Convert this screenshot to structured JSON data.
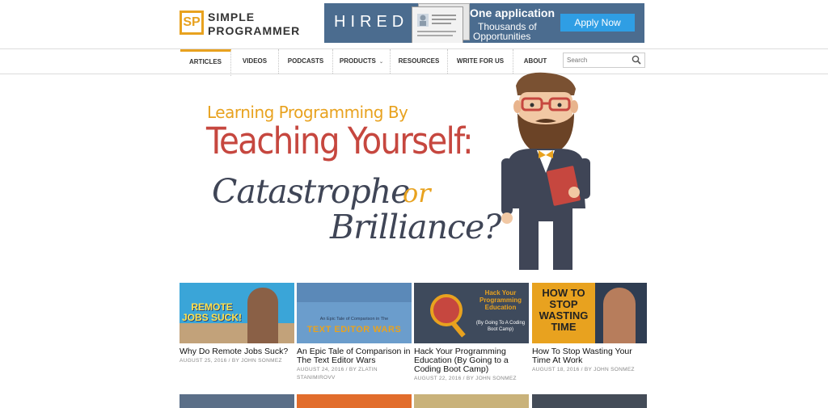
{
  "logo": {
    "mark": "SP",
    "line1": "SIMPLE",
    "line2": "PROGRAMMER"
  },
  "ad": {
    "brand": "HIRED",
    "headline": "One application",
    "sub1": "Thousands of",
    "sub2": "Opportunities",
    "cta": "Apply Now",
    "colors": {
      "background": "#4b6c8f",
      "button": "#2f9ee4"
    }
  },
  "nav": {
    "items": [
      {
        "label": "ARTICLES",
        "active": true
      },
      {
        "label": "VIDEOS"
      },
      {
        "label": "PODCASTS"
      },
      {
        "label": "PRODUCTS",
        "dropdown": true
      },
      {
        "label": "RESOURCES"
      },
      {
        "label": "WRITE FOR US"
      },
      {
        "label": "ABOUT"
      }
    ],
    "search_placeholder": "Search"
  },
  "hero": {
    "line1": "Learning Programming By",
    "line2": "Teaching Yourself:",
    "line3a": "Catastrophe",
    "line3b": "or",
    "line4": "Brilliance?",
    "colors": {
      "accent": "#e8a21f",
      "red": "#c6473f",
      "dark": "#3f4556"
    }
  },
  "cards": [
    {
      "thumb": "REMOTE JOBS SUCK!",
      "title": "Why Do Remote Jobs Suck?",
      "meta1": "AUGUST 25, 2016 / BY JOHN SONMEZ",
      "meta2": ""
    },
    {
      "thumb": "TEXT EDITOR WARS",
      "thumb_sub": "An Epic Tale of Comparison in The",
      "title": "An Epic Tale of Comparison in The Text Editor Wars",
      "meta1": "AUGUST 24, 2016 / BY ZLATIN",
      "meta2": "STANIMIROVV"
    },
    {
      "thumb": "Hack Your Programming Education",
      "thumb_sub": "(By Going To A Coding Boot Camp)",
      "title": "Hack Your Programming Education (By Going to a Coding Boot Camp)",
      "meta1": "AUGUST 22, 2016 / BY JOHN SONMEZ",
      "meta2": ""
    },
    {
      "thumb": "HOW TO STOP WASTING TIME",
      "title": "How To Stop Wasting Your Time At Work",
      "meta1": "AUGUST 18, 2016 / BY JOHN SONMEZ",
      "meta2": ""
    }
  ]
}
